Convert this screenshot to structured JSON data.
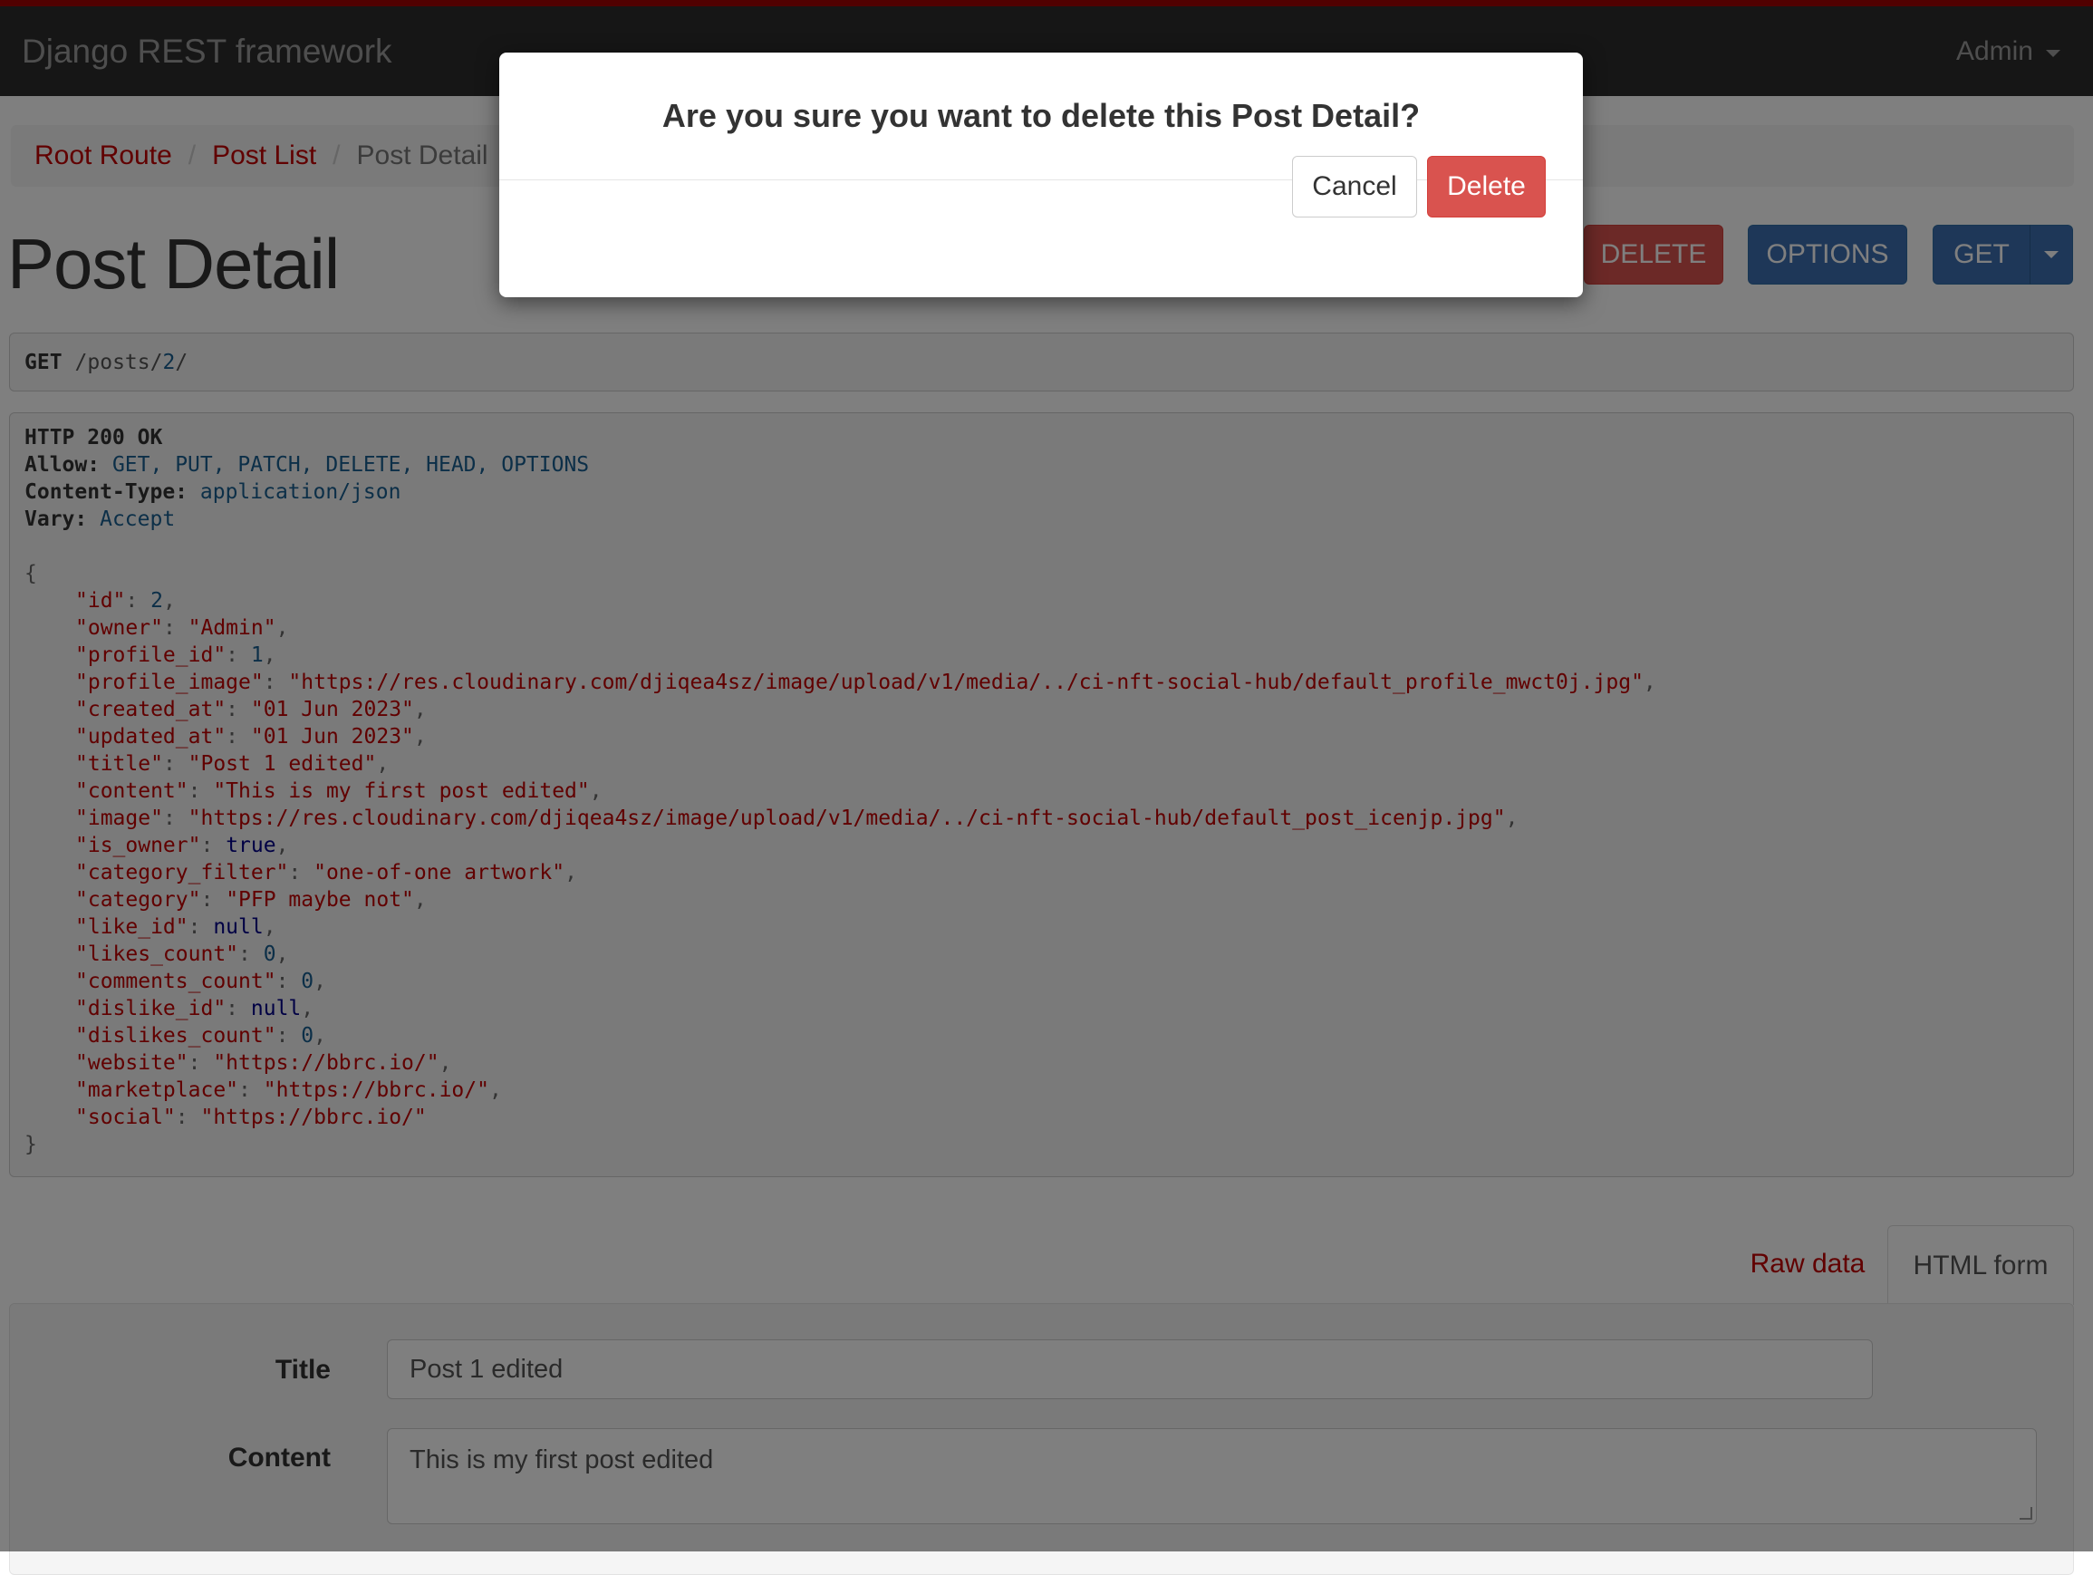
{
  "navbar": {
    "brand": "Django REST framework",
    "user": "Admin"
  },
  "breadcrumb": {
    "items": [
      "Root Route",
      "Post List",
      "Post Detail"
    ]
  },
  "page": {
    "title": "Post Detail"
  },
  "actions": {
    "delete_label": "DELETE",
    "options_label": "OPTIONS",
    "get_label": "GET"
  },
  "request": {
    "method": "GET",
    "path_prefix": "/posts/",
    "path_id": "2",
    "path_suffix": "/"
  },
  "response": {
    "status": "HTTP 200 OK",
    "headers": [
      {
        "key": "Allow:",
        "value": "GET, PUT, PATCH, DELETE, HEAD, OPTIONS"
      },
      {
        "key": "Content-Type:",
        "value": "application/json"
      },
      {
        "key": "Vary:",
        "value": "Accept"
      }
    ],
    "json_open": "{",
    "json_close": "}",
    "fields": [
      {
        "key": "\"id\"",
        "value": "2",
        "type": "num",
        "comma": ","
      },
      {
        "key": "\"owner\"",
        "value": "\"Admin\"",
        "type": "str",
        "comma": ","
      },
      {
        "key": "\"profile_id\"",
        "value": "1",
        "type": "num",
        "comma": ","
      },
      {
        "key": "\"profile_image\"",
        "value": "\"https://res.cloudinary.com/djiqea4sz/image/upload/v1/media/../ci-nft-social-hub/default_profile_mwct0j.jpg\"",
        "type": "str",
        "comma": ","
      },
      {
        "key": "\"created_at\"",
        "value": "\"01 Jun 2023\"",
        "type": "str",
        "comma": ","
      },
      {
        "key": "\"updated_at\"",
        "value": "\"01 Jun 2023\"",
        "type": "str",
        "comma": ","
      },
      {
        "key": "\"title\"",
        "value": "\"Post 1 edited\"",
        "type": "str",
        "comma": ","
      },
      {
        "key": "\"content\"",
        "value": "\"This is my first post edited\"",
        "type": "str",
        "comma": ","
      },
      {
        "key": "\"image\"",
        "value": "\"https://res.cloudinary.com/djiqea4sz/image/upload/v1/media/../ci-nft-social-hub/default_post_icenjp.jpg\"",
        "type": "str",
        "comma": ","
      },
      {
        "key": "\"is_owner\"",
        "value": "true",
        "type": "lit",
        "comma": ","
      },
      {
        "key": "\"category_filter\"",
        "value": "\"one-of-one artwork\"",
        "type": "str",
        "comma": ","
      },
      {
        "key": "\"category\"",
        "value": "\"PFP maybe not\"",
        "type": "str",
        "comma": ","
      },
      {
        "key": "\"like_id\"",
        "value": "null",
        "type": "lit",
        "comma": ","
      },
      {
        "key": "\"likes_count\"",
        "value": "0",
        "type": "num",
        "comma": ","
      },
      {
        "key": "\"comments_count\"",
        "value": "0",
        "type": "num",
        "comma": ","
      },
      {
        "key": "\"dislike_id\"",
        "value": "null",
        "type": "lit",
        "comma": ","
      },
      {
        "key": "\"dislikes_count\"",
        "value": "0",
        "type": "num",
        "comma": ","
      },
      {
        "key": "\"website\"",
        "value": "\"https://bbrc.io/\"",
        "type": "str",
        "comma": ","
      },
      {
        "key": "\"marketplace\"",
        "value": "\"https://bbrc.io/\"",
        "type": "str",
        "comma": ","
      },
      {
        "key": "\"social\"",
        "value": "\"https://bbrc.io/\"",
        "type": "str",
        "comma": ""
      }
    ]
  },
  "tabs": {
    "raw_data": "Raw data",
    "html_form": "HTML form"
  },
  "form": {
    "title_label": "Title",
    "title_value": "Post 1 edited",
    "content_label": "Content",
    "content_value": "This is my first post edited"
  },
  "modal": {
    "title": "Are you sure you want to delete this Post Detail?",
    "cancel_label": "Cancel",
    "delete_label": "Delete"
  },
  "colors": {
    "navbar_bg": "#2c2c2c",
    "navbar_accent": "#a30000",
    "link": "#c20000",
    "danger": "#d9534f",
    "primary": "#3d6fb0"
  }
}
